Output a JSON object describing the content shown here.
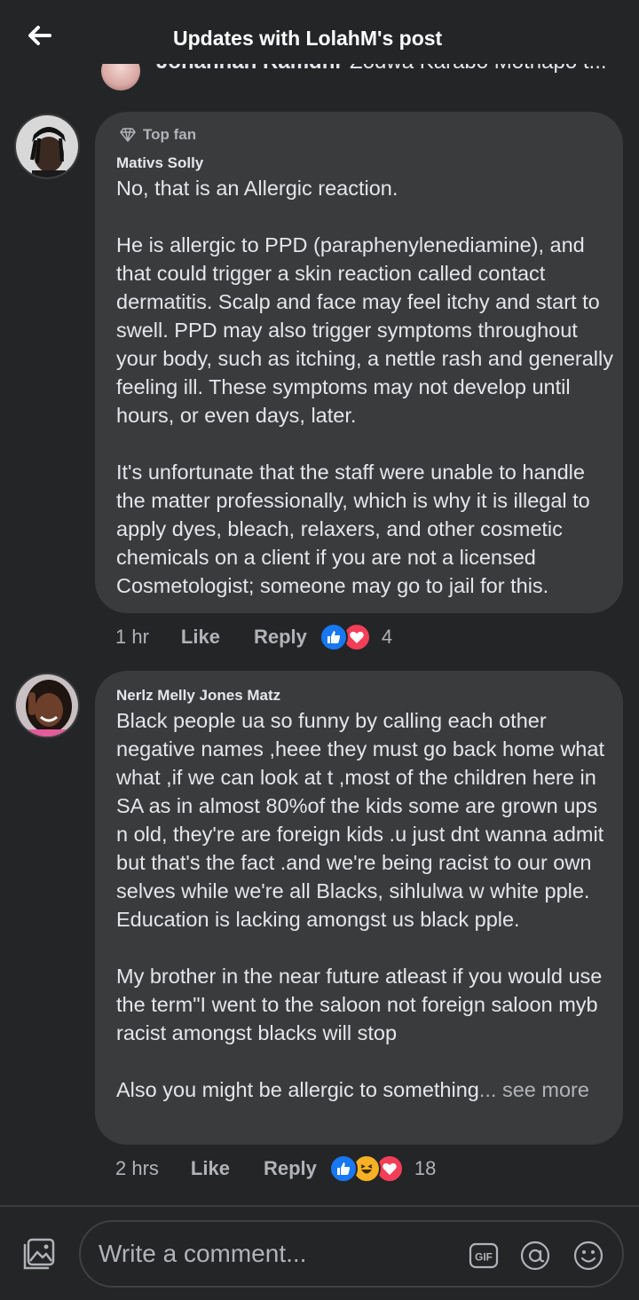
{
  "header": {
    "title": "Updates with LolahM's post"
  },
  "peek": {
    "name": "Johannah Ramdhi",
    "text": "Zodwa Karabo Mothapo t..."
  },
  "comments": [
    {
      "badge": "Top fan",
      "author": "Mativs Solly",
      "text": "No, that is an Allergic reaction.\n\nHe is allergic to PPD (paraphenylenediamine), and that could trigger a skin reaction called contact dermatitis. Scalp and face may feel itchy and start to swell. PPD may also trigger symptoms throughout your body, such as itching, a nettle rash and generally feeling ill. These symptoms may not develop until hours, or even days, later.\n\nIt's unfortunate that the staff were unable to handle the matter professionally, which is why it is illegal to apply dyes, bleach, relaxers, and other cosmetic chemicals on a client if you are not a licensed Cosmetologist; someone may go to jail for this.",
      "time": "1 hr",
      "like_label": "Like",
      "reply_label": "Reply",
      "reactions": [
        "like",
        "love"
      ],
      "reaction_count": "4"
    },
    {
      "author": "Nerlz Melly Jones Matz",
      "text": "Black people ua so funny by calling each other negative names ,heee they must go back home what what ,if we can look at t ,most of the children here in SA as in almost 80%of the kids some are grown ups n old, they're are foreign kids .u just dnt wanna admit but that's the fact .and we're being racist to our own selves while we're all Blacks, sihlulwa w white pple.\nEducation is lacking amongst us black pple.\n\nMy brother in the near future atleast if you would use the term\"I went to the saloon not foreign saloon myb racist amongst blacks will stop\n\nAlso you might be allergic to something",
      "see_more": "... see more",
      "time": "2 hrs",
      "like_label": "Like",
      "reply_label": "Reply",
      "reactions": [
        "like",
        "haha",
        "love"
      ],
      "reaction_count": "18"
    }
  ],
  "composer": {
    "placeholder": "Write a comment..."
  },
  "icons": {
    "back": "arrow-left-icon",
    "photo": "photo-icon",
    "gif": "gif-icon",
    "mention": "at-icon",
    "emoji": "emoji-icon"
  },
  "colors": {
    "background": "#242526",
    "bubble": "#3a3b3c",
    "like": "#1877f2",
    "love": "#f33e58",
    "haha": "#f7b125"
  }
}
